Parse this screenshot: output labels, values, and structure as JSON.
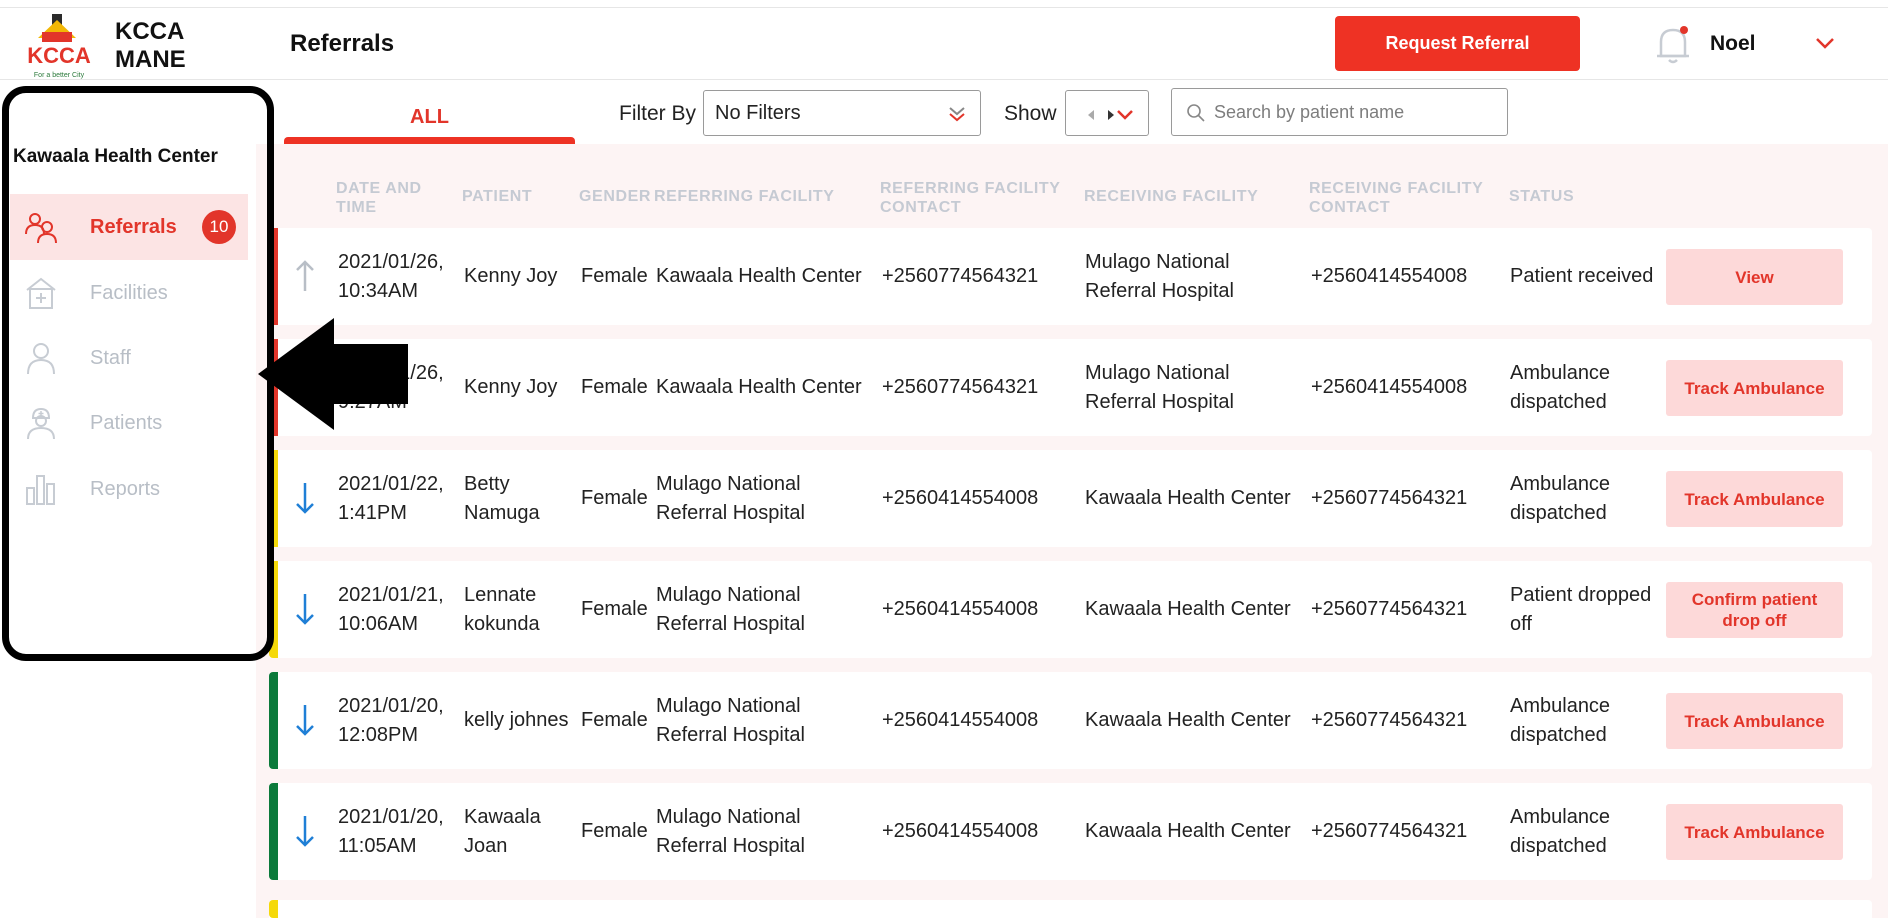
{
  "brand": {
    "line1": "KCCA",
    "line2": "MANE",
    "logo_text": "KCCA",
    "logo_tagline": "For a better City"
  },
  "header": {
    "title": "Referrals",
    "request_button": "Request Referral",
    "user": "Noel"
  },
  "sidebar": {
    "facility": "Kawaala Health Center",
    "items": [
      {
        "label": "Referrals",
        "icon": "referrals-icon",
        "active": true,
        "badge": "10"
      },
      {
        "label": "Facilities",
        "icon": "facility-icon"
      },
      {
        "label": "Staff",
        "icon": "staff-icon"
      },
      {
        "label": "Patients",
        "icon": "patients-icon"
      },
      {
        "label": "Reports",
        "icon": "reports-icon"
      }
    ]
  },
  "filters": {
    "tab_all": "ALL",
    "filter_label": "Filter By",
    "filter_value": "No Filters",
    "show_label": "Show",
    "search_placeholder": "Search by patient name"
  },
  "table": {
    "headers": {
      "date": "DATE AND TIME",
      "patient": "PATIENT",
      "gender": "GENDER",
      "referring": "REFERRING FACILITY",
      "referring_contact": "REFERRING FACILITY CONTACT",
      "receiving": "RECEIVING FACILITY",
      "receiving_contact": "RECEIVING FACILITY CONTACT",
      "status": "STATUS"
    },
    "rows": [
      {
        "date1": "2021/01/26,",
        "date2": "10:34AM",
        "patient1": "Kenny Joy",
        "patient2": "",
        "gender": "Female",
        "ref1": "Kawaala Health Center",
        "ref2": "",
        "ref_contact": "+2560774564321",
        "rec1": "Mulago National",
        "rec2": "Referral Hospital",
        "rec_contact": "+2560414554008",
        "status1": "Patient received",
        "status2": "",
        "action": "View",
        "direction": "outgoing",
        "stripe": "#e2352a"
      },
      {
        "date1": "2021/01/26,",
        "date2": "9:27AM",
        "patient1": "Kenny Joy",
        "patient2": "",
        "gender": "Female",
        "ref1": "Kawaala Health Center",
        "ref2": "",
        "ref_contact": "+2560774564321",
        "rec1": "Mulago National",
        "rec2": "Referral Hospital",
        "rec_contact": "+2560414554008",
        "status1": "Ambulance",
        "status2": "dispatched",
        "action": "Track Ambulance",
        "direction": "outgoing",
        "stripe": "#e2352a"
      },
      {
        "date1": "2021/01/22,",
        "date2": "1:41PM",
        "patient1": "Betty",
        "patient2": "Namuga",
        "gender": "Female",
        "ref1": "Mulago National",
        "ref2": "Referral Hospital",
        "ref_contact": "+2560414554008",
        "rec1": "Kawaala Health Center",
        "rec2": "",
        "rec_contact": "+2560774564321",
        "status1": "Ambulance",
        "status2": "dispatched",
        "action": "Track Ambulance",
        "direction": "incoming",
        "stripe": "#f5d90a"
      },
      {
        "date1": "2021/01/21,",
        "date2": "10:06AM",
        "patient1": "Lennate",
        "patient2": "kokunda",
        "gender": "Female",
        "ref1": "Mulago National",
        "ref2": "Referral Hospital",
        "ref_contact": "+2560414554008",
        "rec1": "Kawaala Health Center",
        "rec2": "",
        "rec_contact": "+2560774564321",
        "status1": "Patient dropped",
        "status2": "off",
        "action": "Confirm patient drop off",
        "direction": "incoming",
        "stripe": "#f5d90a"
      },
      {
        "date1": "2021/01/20,",
        "date2": "12:08PM",
        "patient1": "kelly johnes",
        "patient2": "",
        "gender": "Female",
        "ref1": "Mulago National",
        "ref2": "Referral Hospital",
        "ref_contact": "+2560414554008",
        "rec1": "Kawaala Health Center",
        "rec2": "",
        "rec_contact": "+2560774564321",
        "status1": "Ambulance",
        "status2": "dispatched",
        "action": "Track Ambulance",
        "direction": "incoming",
        "stripe": "#0b7a3b"
      },
      {
        "date1": "2021/01/20,",
        "date2": "11:05AM",
        "patient1": "Kawaala",
        "patient2": "Joan",
        "gender": "Female",
        "ref1": "Mulago National",
        "ref2": "Referral Hospital",
        "ref_contact": "+2560414554008",
        "rec1": "Kawaala Health Center",
        "rec2": "",
        "rec_contact": "+2560774564321",
        "status1": "Ambulance",
        "status2": "dispatched",
        "action": "Track Ambulance",
        "direction": "incoming",
        "stripe": "#0b7a3b"
      }
    ]
  },
  "colors": {
    "accent": "#ee3224",
    "muted": "#b8bec6",
    "incoming": "#1f7fd6",
    "outgoing": "#b8bec6"
  }
}
